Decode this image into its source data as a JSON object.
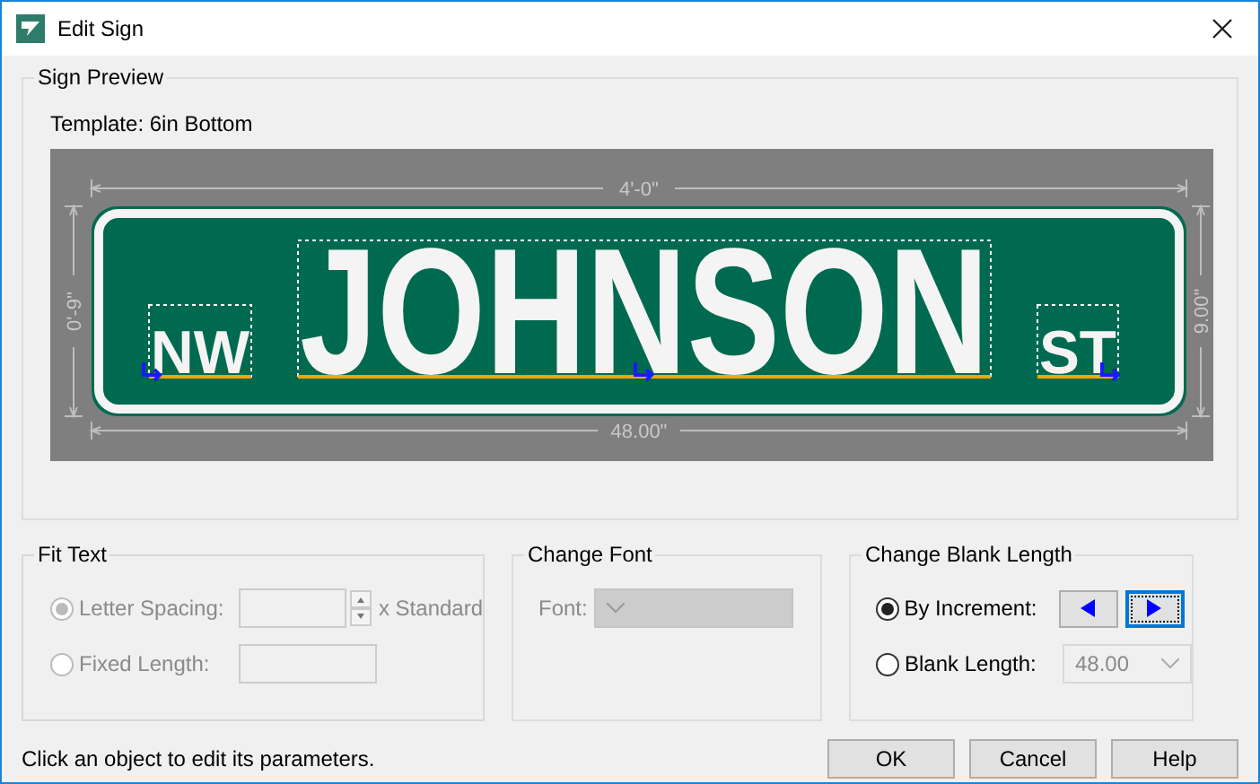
{
  "window": {
    "title": "Edit Sign"
  },
  "sign_preview": {
    "title": "Sign Preview",
    "template": "Template: 6in Bottom",
    "dimensions": {
      "top": "4'-0\"",
      "bottom": "48.00\"",
      "left": "0'-9\"",
      "right": "9.00\""
    },
    "texts": [
      {
        "text": "NW",
        "kind": "prefix"
      },
      {
        "text": "JOHNSON",
        "kind": "name"
      },
      {
        "text": "ST",
        "kind": "suffix"
      }
    ]
  },
  "fit_text": {
    "title": "Fit Text",
    "disabled": true,
    "options": [
      {
        "label": "Letter Spacing:",
        "selected": true,
        "kind": "spinner",
        "suffix": "x Standard"
      },
      {
        "label": "Fixed Length:",
        "selected": false,
        "kind": "field"
      }
    ]
  },
  "change_font": {
    "title": "Change Font",
    "label": "Font:",
    "disabled": true
  },
  "change_blank_length": {
    "title": "Change Blank Length",
    "options": [
      {
        "label": "By Increment:",
        "selected": true,
        "kind": "arrows"
      },
      {
        "label": "Blank Length:",
        "selected": false,
        "kind": "combo",
        "value": "48.00"
      }
    ]
  },
  "status": "Click an object to edit its parameters.",
  "buttons": [
    {
      "label": "OK"
    },
    {
      "label": "Cancel"
    },
    {
      "label": "Help"
    }
  ]
}
